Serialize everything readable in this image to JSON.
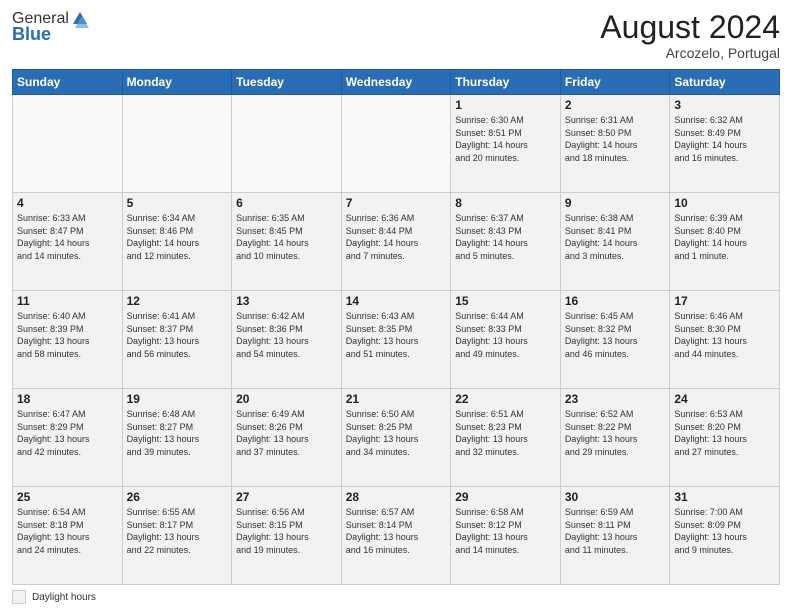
{
  "header": {
    "logo_general": "General",
    "logo_blue": "Blue",
    "month_year": "August 2024",
    "location": "Arcozelo, Portugal"
  },
  "legend": {
    "label": "Daylight hours"
  },
  "weekdays": [
    "Sunday",
    "Monday",
    "Tuesday",
    "Wednesday",
    "Thursday",
    "Friday",
    "Saturday"
  ],
  "weeks": [
    [
      {
        "day": "",
        "info": "",
        "empty": true
      },
      {
        "day": "",
        "info": "",
        "empty": true
      },
      {
        "day": "",
        "info": "",
        "empty": true
      },
      {
        "day": "",
        "info": "",
        "empty": true
      },
      {
        "day": "1",
        "info": "Sunrise: 6:30 AM\nSunset: 8:51 PM\nDaylight: 14 hours\nand 20 minutes.",
        "empty": false
      },
      {
        "day": "2",
        "info": "Sunrise: 6:31 AM\nSunset: 8:50 PM\nDaylight: 14 hours\nand 18 minutes.",
        "empty": false
      },
      {
        "day": "3",
        "info": "Sunrise: 6:32 AM\nSunset: 8:49 PM\nDaylight: 14 hours\nand 16 minutes.",
        "empty": false
      }
    ],
    [
      {
        "day": "4",
        "info": "Sunrise: 6:33 AM\nSunset: 8:47 PM\nDaylight: 14 hours\nand 14 minutes.",
        "empty": false
      },
      {
        "day": "5",
        "info": "Sunrise: 6:34 AM\nSunset: 8:46 PM\nDaylight: 14 hours\nand 12 minutes.",
        "empty": false
      },
      {
        "day": "6",
        "info": "Sunrise: 6:35 AM\nSunset: 8:45 PM\nDaylight: 14 hours\nand 10 minutes.",
        "empty": false
      },
      {
        "day": "7",
        "info": "Sunrise: 6:36 AM\nSunset: 8:44 PM\nDaylight: 14 hours\nand 7 minutes.",
        "empty": false
      },
      {
        "day": "8",
        "info": "Sunrise: 6:37 AM\nSunset: 8:43 PM\nDaylight: 14 hours\nand 5 minutes.",
        "empty": false
      },
      {
        "day": "9",
        "info": "Sunrise: 6:38 AM\nSunset: 8:41 PM\nDaylight: 14 hours\nand 3 minutes.",
        "empty": false
      },
      {
        "day": "10",
        "info": "Sunrise: 6:39 AM\nSunset: 8:40 PM\nDaylight: 14 hours\nand 1 minute.",
        "empty": false
      }
    ],
    [
      {
        "day": "11",
        "info": "Sunrise: 6:40 AM\nSunset: 8:39 PM\nDaylight: 13 hours\nand 58 minutes.",
        "empty": false
      },
      {
        "day": "12",
        "info": "Sunrise: 6:41 AM\nSunset: 8:37 PM\nDaylight: 13 hours\nand 56 minutes.",
        "empty": false
      },
      {
        "day": "13",
        "info": "Sunrise: 6:42 AM\nSunset: 8:36 PM\nDaylight: 13 hours\nand 54 minutes.",
        "empty": false
      },
      {
        "day": "14",
        "info": "Sunrise: 6:43 AM\nSunset: 8:35 PM\nDaylight: 13 hours\nand 51 minutes.",
        "empty": false
      },
      {
        "day": "15",
        "info": "Sunrise: 6:44 AM\nSunset: 8:33 PM\nDaylight: 13 hours\nand 49 minutes.",
        "empty": false
      },
      {
        "day": "16",
        "info": "Sunrise: 6:45 AM\nSunset: 8:32 PM\nDaylight: 13 hours\nand 46 minutes.",
        "empty": false
      },
      {
        "day": "17",
        "info": "Sunrise: 6:46 AM\nSunset: 8:30 PM\nDaylight: 13 hours\nand 44 minutes.",
        "empty": false
      }
    ],
    [
      {
        "day": "18",
        "info": "Sunrise: 6:47 AM\nSunset: 8:29 PM\nDaylight: 13 hours\nand 42 minutes.",
        "empty": false
      },
      {
        "day": "19",
        "info": "Sunrise: 6:48 AM\nSunset: 8:27 PM\nDaylight: 13 hours\nand 39 minutes.",
        "empty": false
      },
      {
        "day": "20",
        "info": "Sunrise: 6:49 AM\nSunset: 8:26 PM\nDaylight: 13 hours\nand 37 minutes.",
        "empty": false
      },
      {
        "day": "21",
        "info": "Sunrise: 6:50 AM\nSunset: 8:25 PM\nDaylight: 13 hours\nand 34 minutes.",
        "empty": false
      },
      {
        "day": "22",
        "info": "Sunrise: 6:51 AM\nSunset: 8:23 PM\nDaylight: 13 hours\nand 32 minutes.",
        "empty": false
      },
      {
        "day": "23",
        "info": "Sunrise: 6:52 AM\nSunset: 8:22 PM\nDaylight: 13 hours\nand 29 minutes.",
        "empty": false
      },
      {
        "day": "24",
        "info": "Sunrise: 6:53 AM\nSunset: 8:20 PM\nDaylight: 13 hours\nand 27 minutes.",
        "empty": false
      }
    ],
    [
      {
        "day": "25",
        "info": "Sunrise: 6:54 AM\nSunset: 8:18 PM\nDaylight: 13 hours\nand 24 minutes.",
        "empty": false
      },
      {
        "day": "26",
        "info": "Sunrise: 6:55 AM\nSunset: 8:17 PM\nDaylight: 13 hours\nand 22 minutes.",
        "empty": false
      },
      {
        "day": "27",
        "info": "Sunrise: 6:56 AM\nSunset: 8:15 PM\nDaylight: 13 hours\nand 19 minutes.",
        "empty": false
      },
      {
        "day": "28",
        "info": "Sunrise: 6:57 AM\nSunset: 8:14 PM\nDaylight: 13 hours\nand 16 minutes.",
        "empty": false
      },
      {
        "day": "29",
        "info": "Sunrise: 6:58 AM\nSunset: 8:12 PM\nDaylight: 13 hours\nand 14 minutes.",
        "empty": false
      },
      {
        "day": "30",
        "info": "Sunrise: 6:59 AM\nSunset: 8:11 PM\nDaylight: 13 hours\nand 11 minutes.",
        "empty": false
      },
      {
        "day": "31",
        "info": "Sunrise: 7:00 AM\nSunset: 8:09 PM\nDaylight: 13 hours\nand 9 minutes.",
        "empty": false
      }
    ]
  ]
}
